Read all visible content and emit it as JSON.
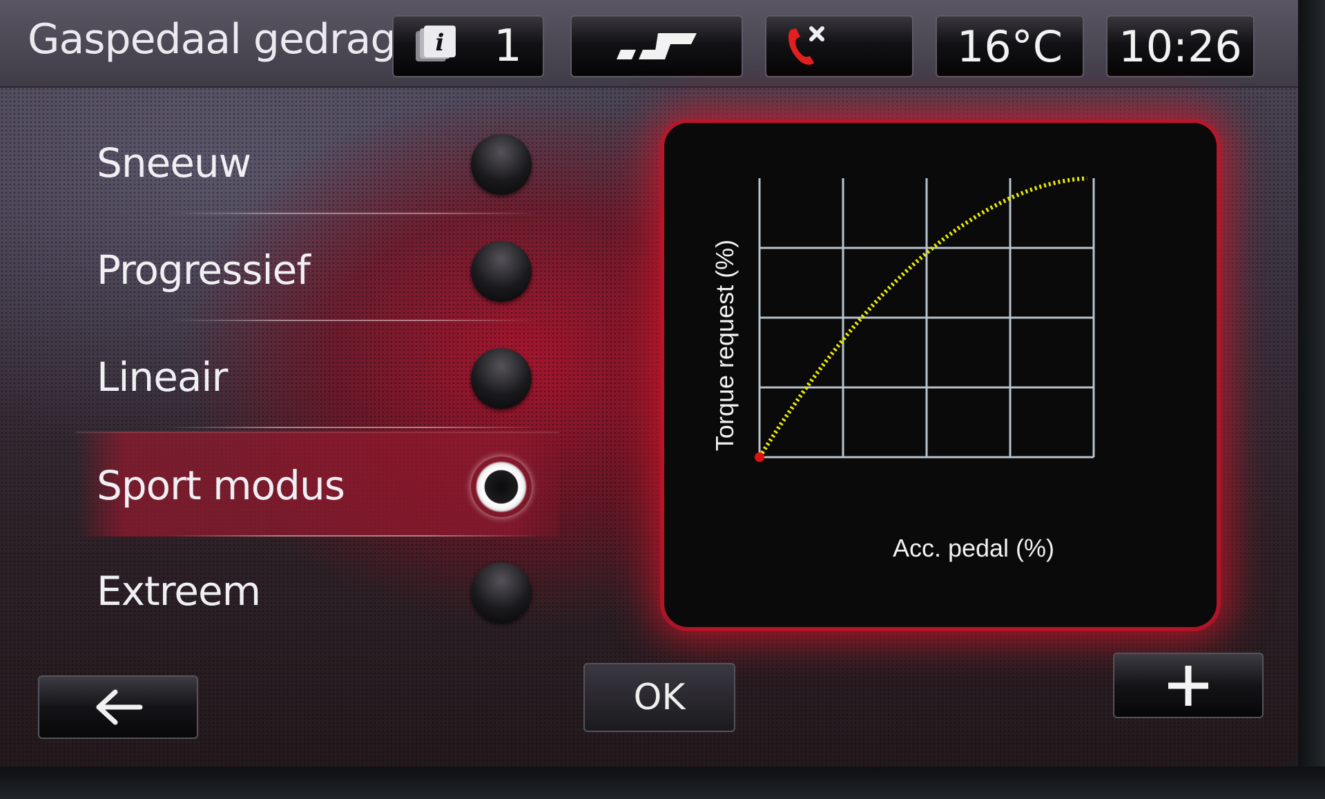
{
  "header": {
    "title": "Gaspedaal gedrag",
    "info_count": "1",
    "temperature": "16°C",
    "time": "10:26"
  },
  "options": [
    {
      "label": "Sneeuw",
      "selected": false
    },
    {
      "label": "Progressief",
      "selected": false
    },
    {
      "label": "Lineair",
      "selected": false
    },
    {
      "label": "Sport modus",
      "selected": true
    },
    {
      "label": "Extreem",
      "selected": false
    }
  ],
  "graph": {
    "xlabel": "Acc. pedal (%)",
    "ylabel": "Torque request (%)"
  },
  "buttons": {
    "ok_label": "OK"
  },
  "colors": {
    "accent_red": "#d01830",
    "curve_yellow": "#e8e800",
    "grid": "#b8c4cc"
  }
}
